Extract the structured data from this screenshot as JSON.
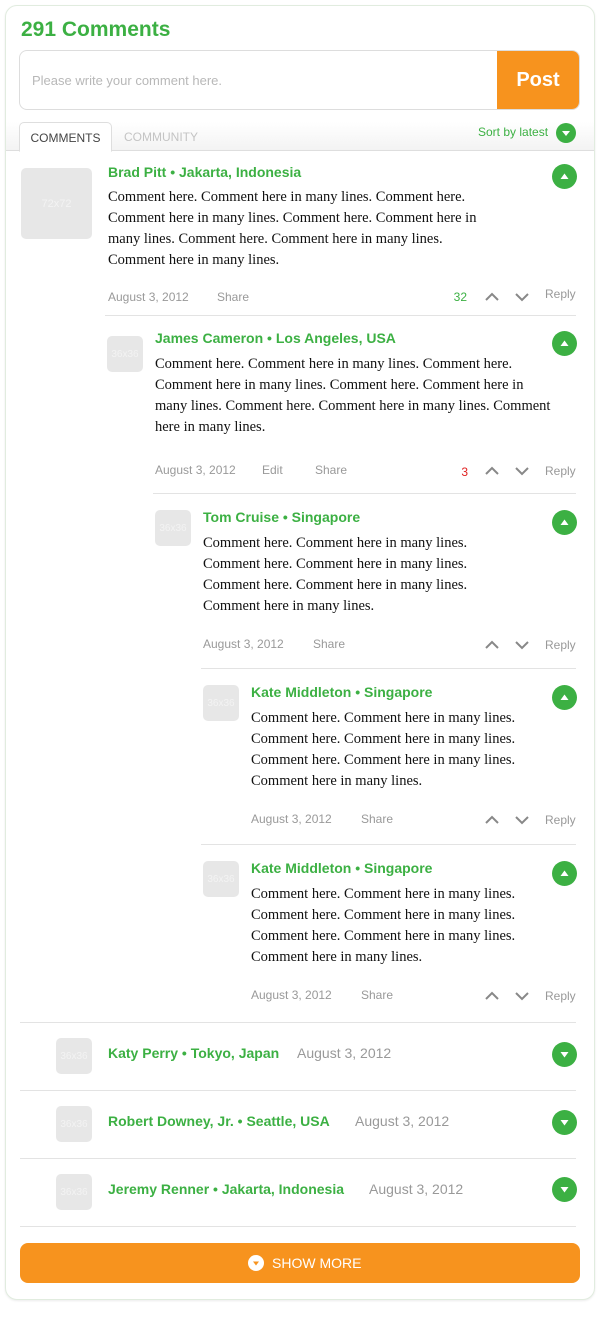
{
  "header": {
    "count_title": "291 Comments"
  },
  "composer": {
    "placeholder": "Please write your comment here.",
    "post_label": "Post"
  },
  "tabs": {
    "active": "COMMENTS",
    "inactive": "COMMUNITY",
    "sort_label": "Sort by latest"
  },
  "comments": [
    {
      "author": "Brad Pitt • Jakarta, Indonesia",
      "avatar": "72x72",
      "body": "Comment here. Comment here in many lines. Comment here. Comment here in many lines. Comment here. Comment here in many lines. Comment here. Comment here in many lines. Comment here in many lines.",
      "date": "August 3, 2012",
      "share": "Share",
      "votes": "32",
      "reply": "Reply"
    },
    {
      "author": "James Cameron • Los Angeles, USA",
      "avatar": "36x36",
      "body": "Comment here. Comment here in many lines. Comment here. Comment here in many lines. Comment here. Comment here in many lines. Comment here. Comment here in many lines. Comment here in many lines.",
      "date": "August 3, 2012",
      "edit": "Edit",
      "share": "Share",
      "votes": "3",
      "reply": "Reply"
    },
    {
      "author": "Tom Cruise • Singapore",
      "avatar": "36x36",
      "body": "Comment here. Comment here in many lines. Comment here. Comment here in many lines. Comment here. Comment here in many lines. Comment here in many lines.",
      "date": "August 3, 2012",
      "share": "Share",
      "reply": "Reply"
    },
    {
      "author": "Kate Middleton • Singapore",
      "avatar": "36x36",
      "body": "Comment here. Comment here in many lines. Comment here. Comment here in many lines. Comment here. Comment here in many lines. Comment here in many lines.",
      "date": "August 3, 2012",
      "share": "Share",
      "reply": "Reply"
    },
    {
      "author": "Kate Middleton • Singapore",
      "avatar": "36x36",
      "body": "Comment here. Comment here in many lines. Comment here. Comment here in many lines. Comment here. Comment here in many lines. Comment here in many lines.",
      "date": "August 3, 2012",
      "share": "Share",
      "reply": "Reply"
    }
  ],
  "collapsed": [
    {
      "author": "Katy Perry • Tokyo, Japan",
      "avatar": "36x36",
      "date": "August 3, 2012"
    },
    {
      "author": "Robert Downey, Jr. • Seattle, USA",
      "avatar": "36x36",
      "date": "August 3, 2012"
    },
    {
      "author": "Jeremy Renner • Jakarta, Indonesia",
      "avatar": "36x36",
      "date": "August 3, 2012"
    }
  ],
  "show_more": {
    "label": "SHOW MORE"
  },
  "colors": {
    "accent_green": "#3cb043",
    "accent_orange": "#f7931e",
    "negative_red": "#e02020"
  }
}
